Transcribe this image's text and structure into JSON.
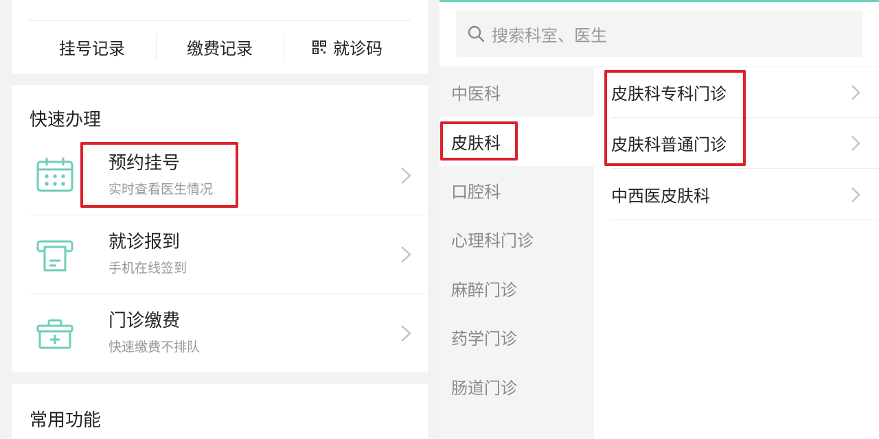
{
  "colors": {
    "accent": "#6cd3c2",
    "highlight": "#d9232a",
    "icon": "#6fcdb9"
  },
  "left": {
    "quick_links": [
      {
        "label": "挂号记录",
        "icon": null
      },
      {
        "label": "缴费记录",
        "icon": null
      },
      {
        "label": "就诊码",
        "icon": "qr-code-icon"
      }
    ],
    "quick_section": {
      "title": "快速办理",
      "items": [
        {
          "title": "预约挂号",
          "subtitle": "实时查看医生情况",
          "icon": "calendar-icon"
        },
        {
          "title": "就诊报到",
          "subtitle": "手机在线签到",
          "icon": "printer-ticket-icon"
        },
        {
          "title": "门诊缴费",
          "subtitle": "快速缴费不排队",
          "icon": "medical-kit-icon"
        }
      ]
    },
    "common_section": {
      "title": "常用功能"
    }
  },
  "right": {
    "search": {
      "placeholder": "搜索科室、医生",
      "icon": "search-icon"
    },
    "departments": [
      {
        "label": "中医科",
        "active": false
      },
      {
        "label": "皮肤科",
        "active": true
      },
      {
        "label": "口腔科",
        "active": false
      },
      {
        "label": "心理科门诊",
        "active": false
      },
      {
        "label": "麻醉门诊",
        "active": false
      },
      {
        "label": "药学门诊",
        "active": false
      },
      {
        "label": "肠道门诊",
        "active": false
      }
    ],
    "clinics": [
      {
        "label": "皮肤科专科门诊"
      },
      {
        "label": "皮肤科普通门诊"
      },
      {
        "label": "中西医皮肤科"
      }
    ]
  }
}
